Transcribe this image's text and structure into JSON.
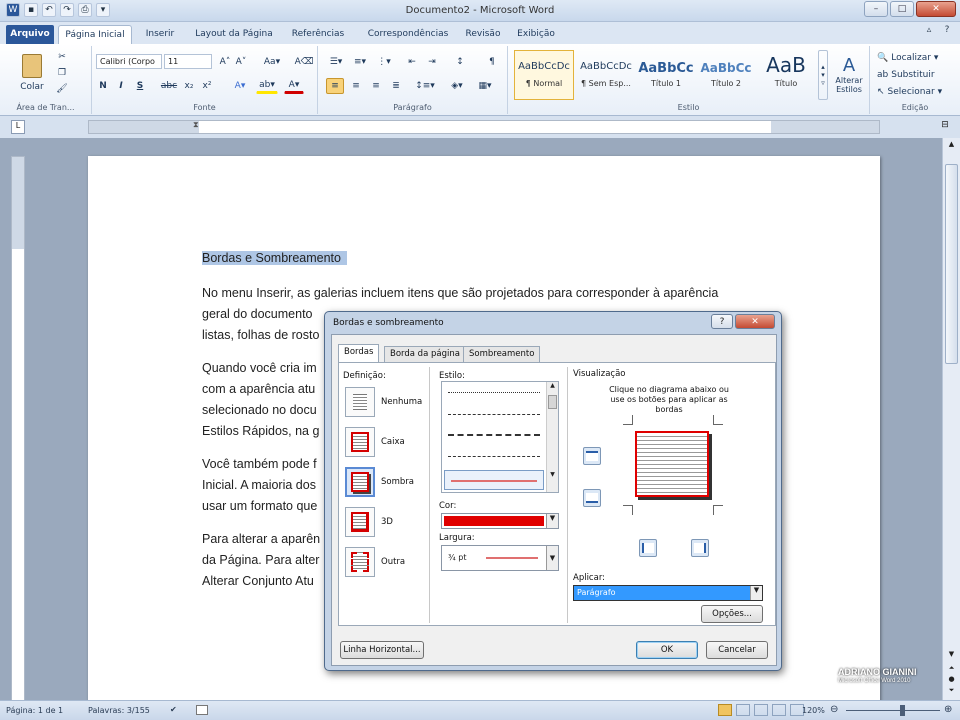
{
  "window": {
    "title": "Documento2 - Microsoft Word"
  },
  "ribbon_tabs": [
    "Arquivo",
    "Página Inicial",
    "Inserir",
    "Layout da Página",
    "Referências",
    "Correspondências",
    "Revisão",
    "Exibição"
  ],
  "ribbon": {
    "clipboard": {
      "paste": "Colar",
      "label": "Área de Tran..."
    },
    "font": {
      "name": "Calibri (Corpo",
      "size": "11",
      "label": "Fonte",
      "bold": "N",
      "italic": "I",
      "underline": "S"
    },
    "paragraph": {
      "label": "Parágrafo"
    },
    "styles": {
      "label": "Estilo",
      "items": [
        {
          "sample": "AaBbCcDc",
          "name": "¶ Normal"
        },
        {
          "sample": "AaBbCcDc",
          "name": "¶ Sem Esp..."
        },
        {
          "sample": "AaBbCc",
          "name": "Título 1"
        },
        {
          "sample": "AaBbCc",
          "name": "Título 2"
        },
        {
          "sample": "AaB",
          "name": "Título"
        }
      ],
      "change": "Alterar Estilos"
    },
    "editing": {
      "find": "Localizar",
      "replace": "Substituir",
      "select": "Selecionar",
      "label": "Edição"
    }
  },
  "document": {
    "heading": "Bordas e Sombreamento",
    "lines": [
      "No menu Inserir, as galerias incluem itens que são projetados para corresponder à aparência",
      "geral do documento",
      "listas, folhas de rosto",
      "Quando você cria im",
      "com a aparência atu",
      "selecionado no docu",
      "Estilos Rápidos, na g",
      "Você também pode f",
      "Inicial. A maioria dos",
      "usar um formato que",
      "Para alterar a aparên",
      "da Página. Para alter",
      "Alterar Conjunto Atu"
    ]
  },
  "dialog": {
    "title": "Bordas e sombreamento",
    "tabs": [
      "Bordas",
      "Borda da página",
      "Sombreamento"
    ],
    "setting_label": "Definição:",
    "settings": [
      "Nenhuma",
      "Caixa",
      "Sombra",
      "3D",
      "Outra"
    ],
    "style_label": "Estilo:",
    "color_label": "Cor:",
    "width_label": "Largura:",
    "width_value": "¾ pt",
    "preview_label": "Visualização",
    "preview_hint": "Clique no diagrama abaixo ou use os botões para aplicar as bordas",
    "apply_label": "Aplicar:",
    "apply_value": "Parágrafo",
    "options": "Opções...",
    "horizontal": "Linha Horizontal...",
    "ok": "OK",
    "cancel": "Cancelar",
    "border_color": "#e00000"
  },
  "status": {
    "page": "Página: 1 de 1",
    "words": "Palavras: 3/155",
    "zoom": "120%"
  },
  "watermark": {
    "name": "ADRIANO GIANINI",
    "sub": "Microsoft Office Word 2010"
  }
}
